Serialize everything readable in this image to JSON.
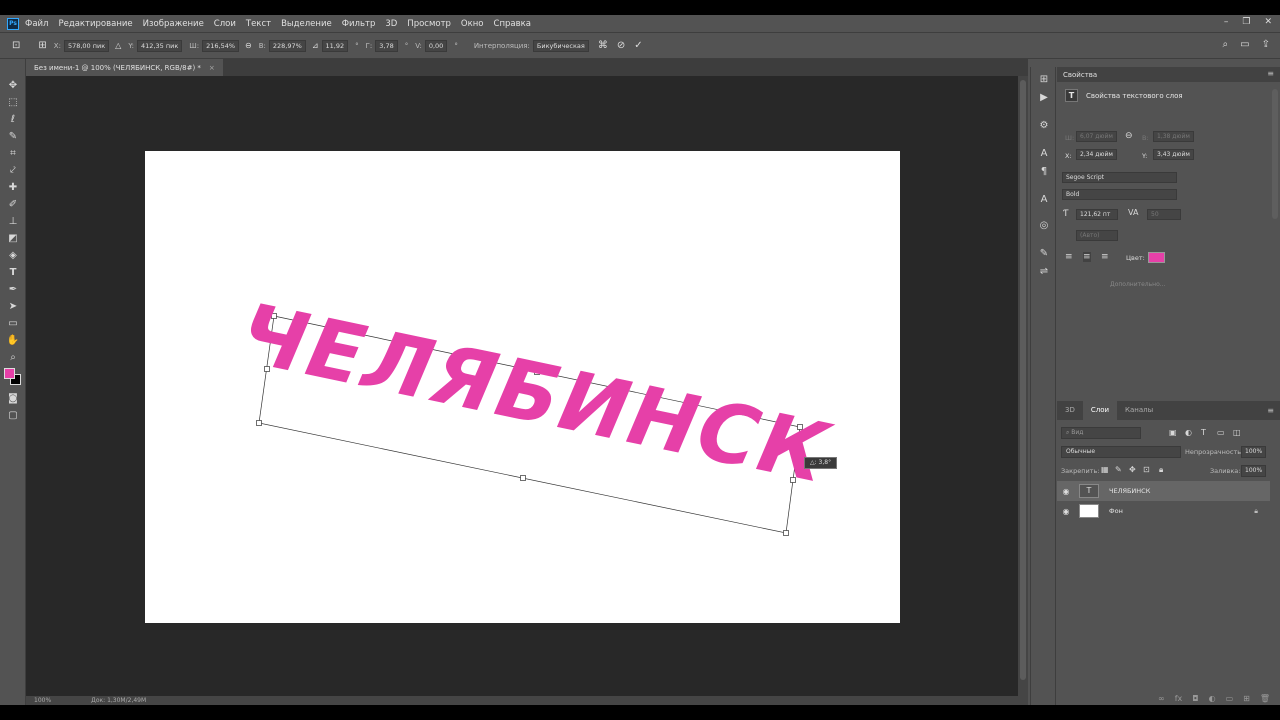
{
  "app": {
    "logo": "Ps"
  },
  "menu": [
    "Файл",
    "Редактирование",
    "Изображение",
    "Слои",
    "Текст",
    "Выделение",
    "Фильтр",
    "3D",
    "Просмотр",
    "Окно",
    "Справка"
  ],
  "window_controls": [
    "–",
    "❐",
    "✕"
  ],
  "options": {
    "x_label": "X:",
    "x_value": "578,00 пик",
    "y_label": "Y:",
    "y_value": "412,35 пик",
    "w_label": "Ш:",
    "w_value": "216,54%",
    "h_label": "В:",
    "h_value": "228,97%",
    "angle_value": "11,92",
    "deg_unit": "°",
    "skew_h_label": "Г:",
    "skew_h_value": "3,78",
    "skew_v_label": "V:",
    "skew_v_value": "0,00",
    "interp_label": "Интерполяция:",
    "interp_value": "Бикубическая"
  },
  "document_tab": {
    "title": "Без имени-1 @ 100% (ЧЕЛЯБИНСК, RGB/8#) *",
    "close": "×"
  },
  "canvas": {
    "text": "ЧЕЛЯБИНСК",
    "text_color": "#e640a8",
    "angle_deg": 11.9,
    "angle_readout": "△: 3,8°"
  },
  "status": {
    "zoom": "100%",
    "doc": "Док: 1,30М/2,49М"
  },
  "properties": {
    "header": "Свойства",
    "title": "Свойства текстового слоя",
    "w_label": "Ш:",
    "w_value": "6,07 дюйм",
    "h_label": "В:",
    "h_value": "1,38 дюйм",
    "x_label": "X:",
    "x_value": "2,34 дюйм",
    "y_label": "Y:",
    "y_value": "3,43 дюйм",
    "font_family": "Segoe Script",
    "font_style": "Bold",
    "font_size": "121,62 пт",
    "tracking_value": "50",
    "leading_value": "(Авто)",
    "color_label": "Цвет:",
    "color": "#e640a8",
    "more": "Дополнительно..."
  },
  "layers": {
    "tabs": [
      "3D",
      "Слои",
      "Каналы"
    ],
    "active_tab": "Слои",
    "search_placeholder": "Вид",
    "blend_mode": "Обычные",
    "opacity_label": "Непрозрачность:",
    "opacity_value": "100%",
    "lock_label": "Закрепить:",
    "fill_label": "Заливка:",
    "fill_value": "100%",
    "items": [
      {
        "name": "ЧЕЛЯБИНСК",
        "type": "text",
        "selected": true
      },
      {
        "name": "Фон",
        "type": "background",
        "selected": false
      }
    ]
  }
}
